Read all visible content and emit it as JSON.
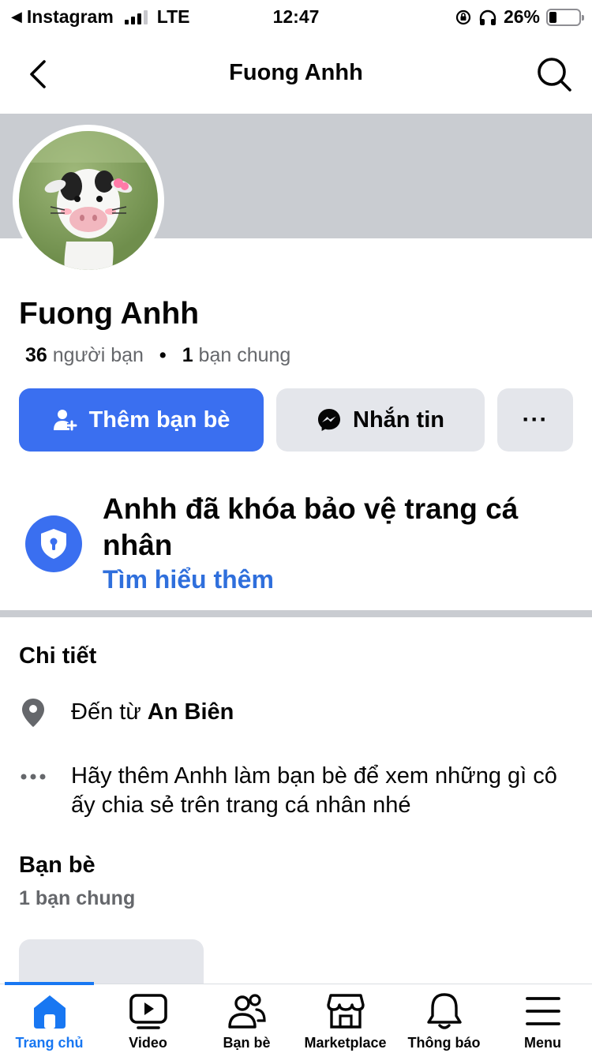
{
  "status_bar": {
    "carrier_app": "Instagram",
    "network": "LTE",
    "time": "12:47",
    "battery": "26%",
    "battery_level": 0.26
  },
  "header": {
    "title": "Fuong Anhh"
  },
  "profile": {
    "name": "Fuong Anhh",
    "friend_count": "36",
    "friend_label": "người bạn",
    "mutual_count": "1",
    "mutual_label": "bạn chung"
  },
  "actions": {
    "add_friend": "Thêm bạn bè",
    "message": "Nhắn tin",
    "more": "···"
  },
  "lock_notice": {
    "title": "Anhh đã khóa bảo vệ trang cá nhân",
    "learn_more": "Tìm hiểu thêm"
  },
  "details": {
    "title": "Chi tiết",
    "from_prefix": "Đến từ",
    "from_place": "An Biên",
    "add_friend_hint": "Hãy thêm Anhh làm bạn bè để xem những gì cô ấy chia sẻ trên trang cá nhân nhé"
  },
  "friends": {
    "title": "Bạn bè",
    "mutual": "1 bạn chung"
  },
  "bottom_nav": {
    "items": [
      {
        "label": "Trang chủ",
        "icon": "home-icon",
        "active": true
      },
      {
        "label": "Video",
        "icon": "video-icon",
        "active": false
      },
      {
        "label": "Bạn bè",
        "icon": "friends-icon",
        "active": false
      },
      {
        "label": "Marketplace",
        "icon": "marketplace-icon",
        "active": false
      },
      {
        "label": "Thông báo",
        "icon": "bell-icon",
        "active": false
      },
      {
        "label": "Menu",
        "icon": "menu-icon",
        "active": false
      }
    ]
  },
  "colors": {
    "primary": "#3a6ff0",
    "link": "#2f6fdc",
    "nav_active": "#1877f2",
    "cover": "#c9ccd1",
    "button_gray": "#e4e6eb"
  }
}
